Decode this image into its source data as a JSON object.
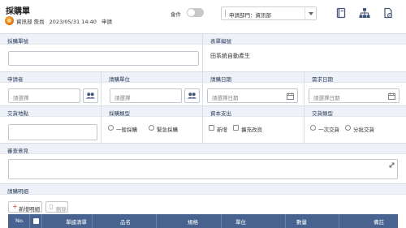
{
  "header": {
    "title": "採購單",
    "author_name": "資訊部 詹尚",
    "timestamp": "2023/05/31 14:40",
    "status": "申請",
    "cc_label": "會件",
    "dept_select_value": "申請部門：資訊部"
  },
  "toolbar": {
    "icons": [
      "book-icon",
      "org-chart-icon",
      "document-settings-icon"
    ]
  },
  "form": {
    "purchase_no": {
      "label": "採購單號",
      "value": ""
    },
    "form_no": {
      "label": "表單編號",
      "value": "田系統自動產生"
    },
    "applicant": {
      "label": "申請者",
      "placeholder": "請選擇"
    },
    "request_unit": {
      "label": "請購單位",
      "placeholder": "請選擇"
    },
    "request_date": {
      "label": "請購日期",
      "placeholder": "請選擇日期"
    },
    "need_date": {
      "label": "需求日期",
      "placeholder": "請選擇日期"
    },
    "delivery_place": {
      "label": "交貨地點",
      "value": ""
    },
    "purchase_type": {
      "label": "採購類型",
      "options": [
        "一般採購",
        "緊急採購"
      ]
    },
    "capital_expense": {
      "label": "資本支出",
      "options": [
        "新增",
        "擴充改良"
      ]
    },
    "delivery_type": {
      "label": "交貨類型",
      "options": [
        "一次交貨",
        "分批交貨"
      ]
    },
    "review_opinion": {
      "label": "審查意見",
      "value": ""
    }
  },
  "details": {
    "label": "請購明細",
    "add_button": "新增明細",
    "delete_button": "刪除",
    "columns": [
      "No.",
      "",
      "單據清單",
      "品名",
      "規格",
      "單位",
      "數量",
      "備註"
    ]
  },
  "colors": {
    "label_bg": "#eef2f8",
    "table_header": "#48638f",
    "accent_add": "#d9332b"
  }
}
